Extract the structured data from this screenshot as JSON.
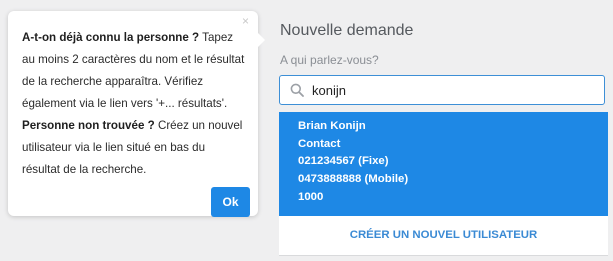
{
  "tooltip": {
    "close_icon": "×",
    "bold1": "A-t-on déjà connu la personne ?",
    "text1": " Tapez au moins 2 caractères du nom et le résultat de la recherche apparaîtra. Vérifiez également via le lien vers '+... résultats'. ",
    "bold2": "Personne non trouvée ?",
    "text2": " Créez un nouvel utilisateur via le lien situé en bas du résultat de la recherche.",
    "ok_label": "Ok"
  },
  "panel": {
    "title": "Nouvelle demande",
    "question_label": "A qui parlez-vous?",
    "search": {
      "value": "konijn",
      "icon": "search-icon"
    },
    "result": {
      "name": "Brian Konijn",
      "role": "Contact",
      "phone_fixed": "021234567 (Fixe)",
      "phone_mobile": "0473888888 (Mobile)",
      "number": "1000"
    },
    "create_user_label": "CRÉER UN NOUVEL UTILISATEUR"
  },
  "colors": {
    "accent": "#1e88e5",
    "background": "#efeff0",
    "link": "#3a8ad4"
  }
}
